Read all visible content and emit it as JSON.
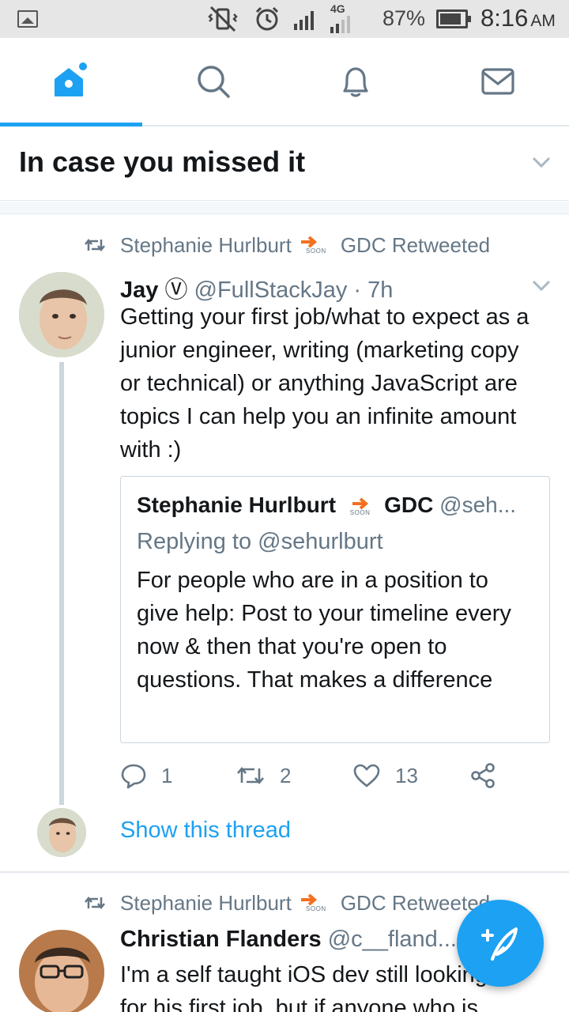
{
  "status_bar": {
    "network": "4G",
    "battery_percent": "87%",
    "time": "8:16",
    "ampm": "AM"
  },
  "tabs": [
    {
      "name": "Home",
      "icon": "home-icon",
      "active": true
    },
    {
      "name": "Search",
      "icon": "search-icon",
      "active": false
    },
    {
      "name": "Notifications",
      "icon": "bell-icon",
      "active": false
    },
    {
      "name": "Messages",
      "icon": "mail-icon",
      "active": false
    }
  ],
  "section": {
    "title": "In case you missed it"
  },
  "tweet1": {
    "retweeted_by_name": "Stephanie Hurlburt",
    "soon_label": "SOON",
    "retweeted_by_suffix": "GDC Retweeted",
    "author_name": "Jay",
    "author_badge": "Ⓥ",
    "handle": "@FullStackJay",
    "time": "· 7h",
    "text": "Getting your first job/what to expect as a junior engineer, writing (marketing copy or technical) or anything JavaScript are topics I can help you an infinite amount with :)",
    "quote": {
      "author_name": "Stephanie Hurlburt",
      "soon_label": "SOON",
      "author_suffix": "GDC",
      "handle": "@seh...",
      "reply_to": "Replying to @sehurlburt",
      "text": "For people who are in a position to give help: Post to your timeline every now & then that you're open to questions. That makes a difference"
    },
    "replies": "1",
    "retweets": "2",
    "likes": "13",
    "show_thread": "Show this thread"
  },
  "tweet2": {
    "retweeted_by_name": "Stephanie Hurlburt",
    "soon_label": "SOON",
    "retweeted_by_suffix": "GDC Retweeted",
    "author_name": "Christian Flanders",
    "handle": "@c__fland...",
    "text_line1": "I'm a self taught iOS dev still looking",
    "text_line2": "for his first job, but if anyone who is"
  },
  "colors": {
    "accent": "#1da1f2",
    "muted": "#657786",
    "soon_orange": "#f37021"
  }
}
